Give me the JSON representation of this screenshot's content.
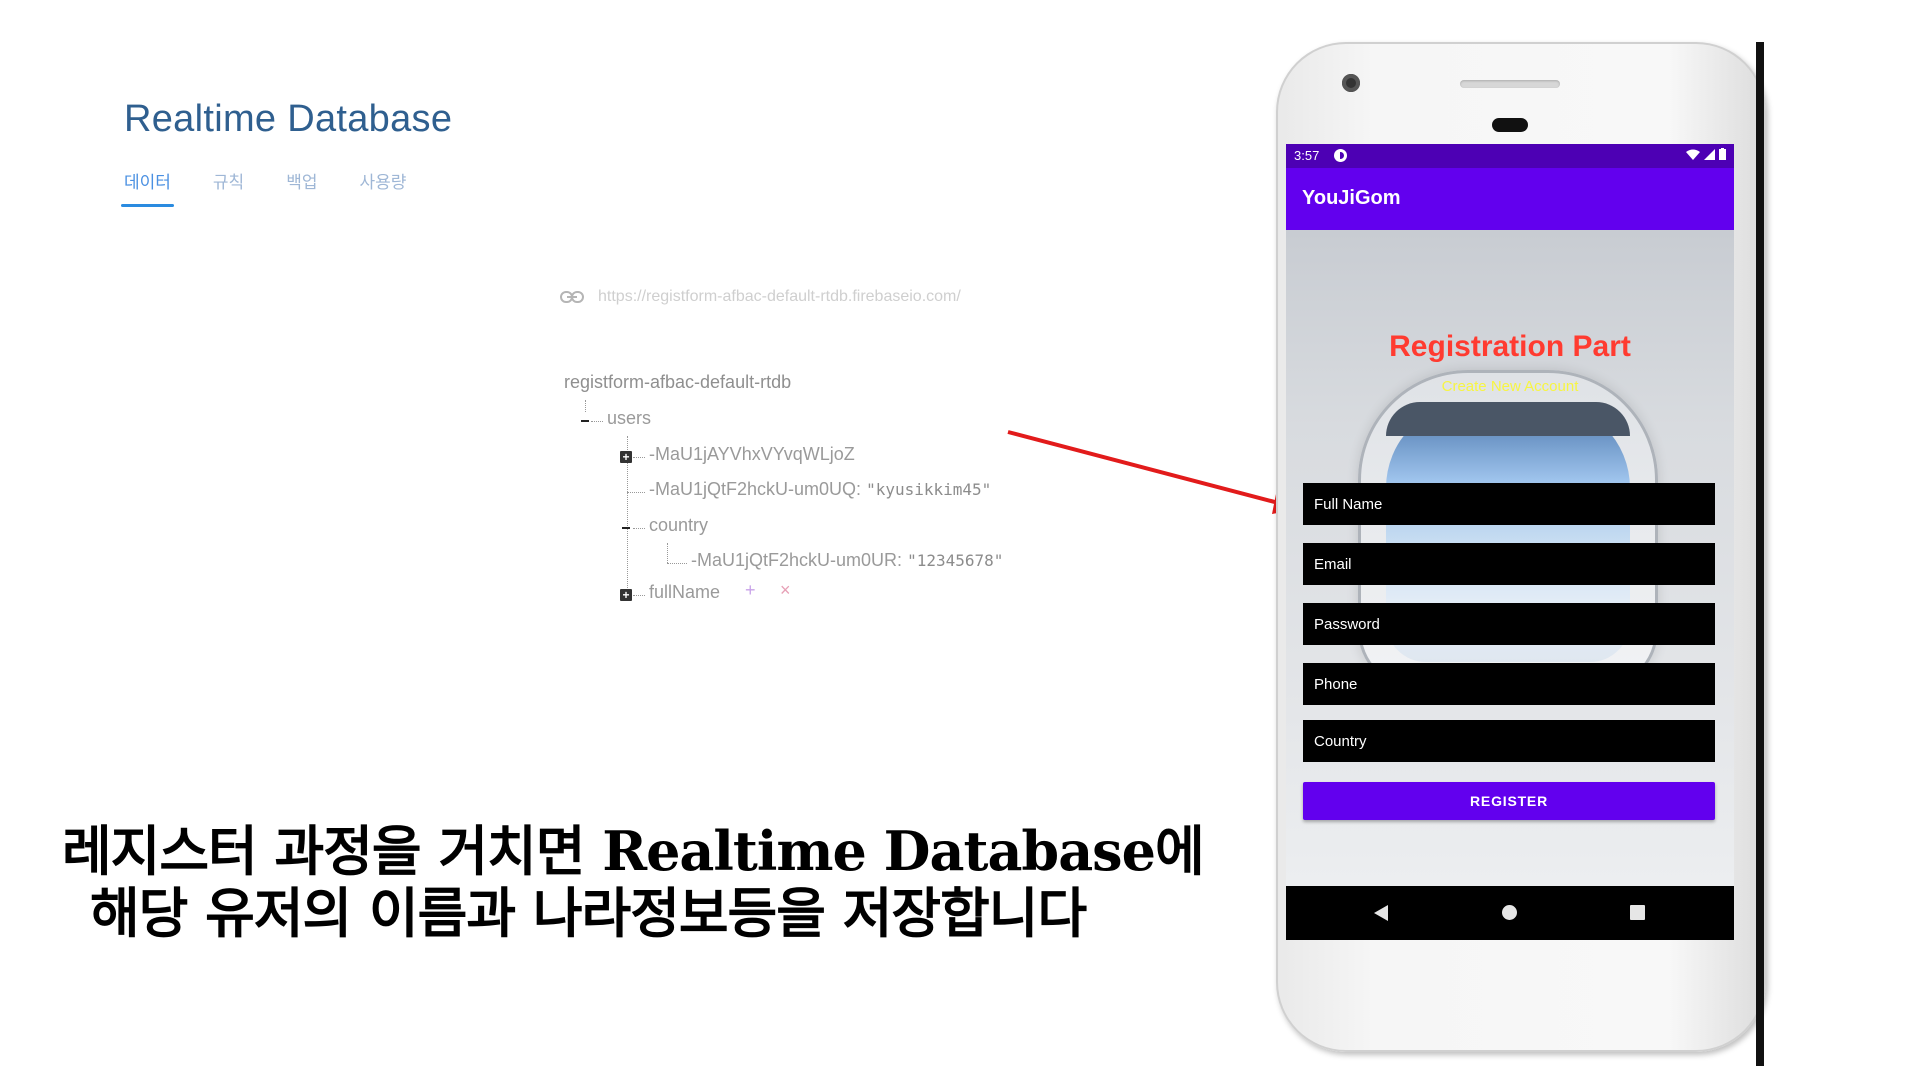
{
  "firebase": {
    "title": "Realtime Database",
    "tabs": [
      {
        "label": "데이터",
        "active": true
      },
      {
        "label": "규칙",
        "active": false
      },
      {
        "label": "백업",
        "active": false
      },
      {
        "label": "사용량",
        "active": false
      }
    ],
    "url": "https://registform-afbac-default-rtdb.firebaseio.com/",
    "tree": {
      "root": "registform-afbac-default-rtdb",
      "users": "users",
      "node1_key": "-MaU1jAYVhxVYvqWLjoZ",
      "node2_key": "-MaU1jQtF2hckU-um0UQ",
      "node2_sep": ":",
      "node2_value": "\"kyusikkim45\"",
      "country": "country",
      "node3_key": "-MaU1jQtF2hckU-um0UR",
      "node3_sep": ":",
      "node3_value": "\"12345678\"",
      "fullName": "fullName",
      "add_symbol": "+",
      "delete_symbol": "×"
    }
  },
  "caption": {
    "line1": "레지스터 과정을 거치면 Realtime Database에",
    "line2": "해당 유저의 이름과 나라정보등을 저장합니다"
  },
  "phone": {
    "status_time": "3:57",
    "app_title": "YouJiGom",
    "reg_title": "Registration Part",
    "reg_subtitle": "Create New Account",
    "fields": [
      "Full Name",
      "Email",
      "Password",
      "Phone",
      "Country"
    ],
    "register_button": "REGISTER"
  },
  "colors": {
    "accent_purple": "#6200ee",
    "status_purple": "#4d00b4",
    "title_red": "#ff3b30",
    "subtitle_yellow": "#f7f542",
    "tab_active_blue": "#2a8be0",
    "arrow_red": "#e21b1b"
  }
}
